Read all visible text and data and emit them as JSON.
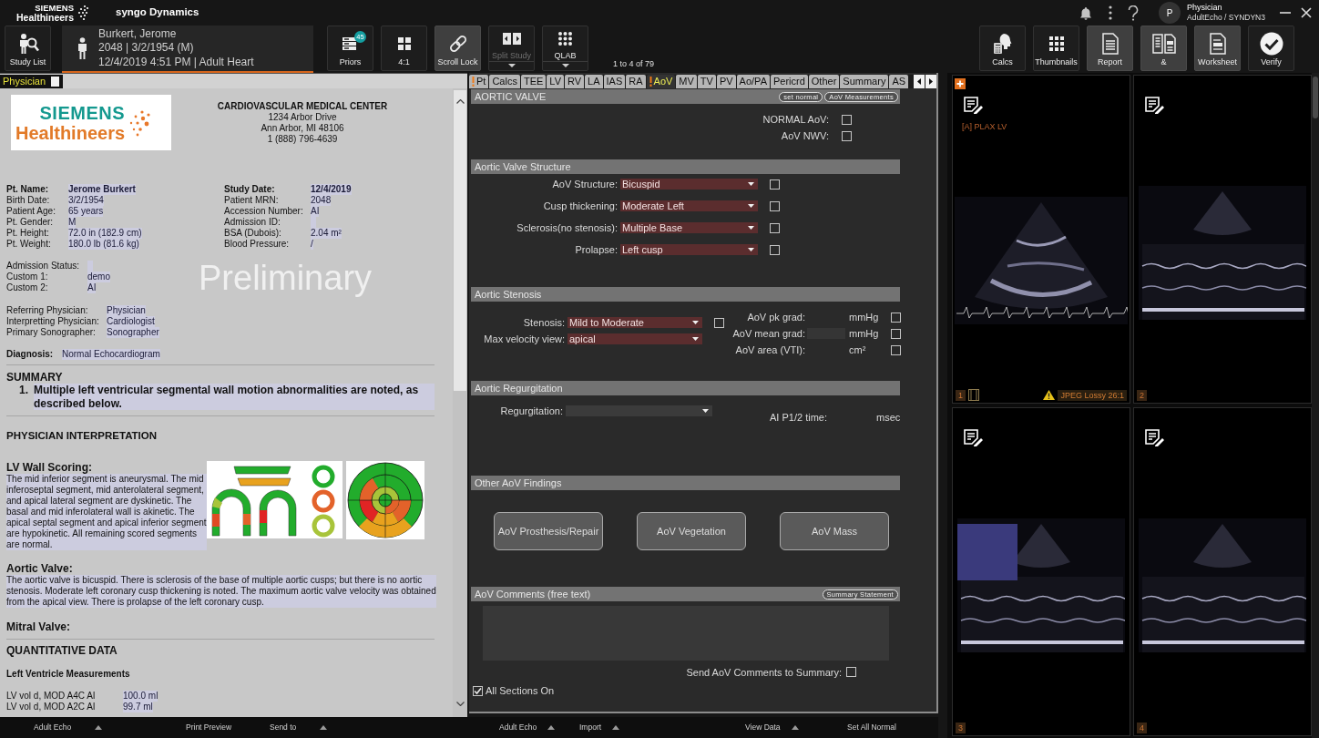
{
  "header": {
    "brand": [
      "SIEMENS",
      "Healthineers"
    ],
    "product": "syngo Dynamics",
    "user": {
      "initial": "P",
      "name": "Physician",
      "context": "AdultEcho / SYNDYN3"
    }
  },
  "toolbar": {
    "left": [
      {
        "kind": "study-list",
        "label": "Study List",
        "selected": false,
        "disabled": false,
        "menu": false
      }
    ],
    "patient": [
      "Burkert, Jerome",
      "2048 | 3/2/1954 (M)",
      "12/4/2019 4:51 PM | Adult Heart"
    ],
    "middle": [
      {
        "kind": "priors",
        "label": "Priors",
        "badge": "45",
        "selected": false,
        "disabled": false,
        "menu": false
      },
      {
        "kind": "layout",
        "label": "4:1",
        "selected": false,
        "disabled": false,
        "menu": false
      },
      {
        "kind": "scroll-lock",
        "label": "Scroll Lock",
        "selected": true,
        "disabled": false,
        "menu": false
      },
      {
        "kind": "split-study",
        "label": "Split Study",
        "selected": false,
        "disabled": true,
        "menu": true
      },
      {
        "kind": "qlab",
        "label": "QLAB",
        "selected": false,
        "disabled": false,
        "menu": true
      }
    ],
    "pager": "1 to 4 of 79",
    "right": [
      {
        "kind": "calcs",
        "label": "Calcs",
        "selected": false,
        "disabled": false,
        "menu": false
      },
      {
        "kind": "thumbnails",
        "label": "Thumbnails",
        "selected": false,
        "disabled": false,
        "menu": false
      },
      {
        "kind": "report",
        "label": "Report",
        "selected": true,
        "disabled": false,
        "menu": false
      },
      {
        "kind": "compare",
        "label": "&",
        "selected": true,
        "disabled": false,
        "menu": false
      },
      {
        "kind": "worksheet",
        "label": "Worksheet",
        "selected": true,
        "disabled": false,
        "menu": false
      },
      {
        "kind": "verify",
        "label": "Verify",
        "selected": false,
        "disabled": false,
        "menu": false
      }
    ]
  },
  "report": {
    "tab": {
      "label": "Physician"
    },
    "logo": [
      "SIEMENS",
      "Healthineers"
    ],
    "facility": [
      "CARDIOVASCULAR MEDICAL CENTER",
      "1234 Arbor Drive",
      "Ann Arbor, MI 48106",
      "1 (888) 796-4639"
    ],
    "watermark": "Preliminary",
    "patient_left": [
      {
        "label": "Pt. Name:",
        "value": "Jerome Burkert",
        "bold": true
      },
      {
        "label": "Birth Date:",
        "value": "3/2/1954",
        "bold": false
      },
      {
        "label": "Patient Age:",
        "value": "65 years",
        "bold": false
      },
      {
        "label": "Pt. Gender:",
        "value": "M",
        "bold": false
      },
      {
        "label": "Pt. Height:",
        "value": "72.0 in (182.9 cm)",
        "bold": false
      },
      {
        "label": "Pt. Weight:",
        "value": "180.0 lb (81.6 kg)",
        "bold": false
      }
    ],
    "patient_right": [
      {
        "label": "Study Date:",
        "value": "12/4/2019",
        "bold": true
      },
      {
        "label": "Patient MRN:",
        "value": "2048",
        "bold": false
      },
      {
        "label": "Accession Number:",
        "value": "AI",
        "bold": false
      },
      {
        "label": "Admission ID:",
        "bold": false
      },
      {
        "label": "BSA (Dubois):",
        "value": "2.04 m²",
        "bold": false
      },
      {
        "label": "Blood Pressure:",
        "value": "/",
        "bold": false
      }
    ],
    "admission": [
      {
        "label": "Admission Status:"
      },
      {
        "label": "Custom 1:",
        "value": "demo"
      },
      {
        "label": "Custom 2:",
        "value": "AI"
      }
    ],
    "staff": [
      {
        "label": "Referring Physician:",
        "value": "Physician"
      },
      {
        "label": "Interpretting Physician:",
        "value": "Cardiologist"
      },
      {
        "label": "Primary Sonographer:",
        "value": "Sonographer"
      }
    ],
    "diagnosis": {
      "label": "Diagnosis:",
      "value": "Normal Echocardiogram"
    },
    "summary": {
      "heading": "SUMMARY",
      "items": [
        {
          "number": "1.",
          "text": "Multiple left ventricular segmental wall motion abnormalities are noted, as described below."
        }
      ]
    },
    "interpretation": {
      "heading": "PHYSICIAN INTERPRETATION",
      "sections": [
        {
          "kind": "figures",
          "heading": "LV Wall Scoring:",
          "text": "The mid inferior segment is aneurysmal. The mid inferoseptal segment, mid anterolateral segment, and apical lateral segment are dyskinetic. The basal and mid inferolateral wall is akinetic. The apical septal segment and apical inferior segment are hypokinetic. All remaining scored segments are normal."
        },
        {
          "kind": "text",
          "heading": "Aortic Valve:",
          "text": "The aortic valve is bicuspid. There is sclerosis of the base of multiple aortic cusps; but there is no aortic stenosis. Moderate left coronary cusp thickening is noted. The maximum aortic valve velocity was obtained from the apical view. There is prolapse of the left coronary cusp."
        },
        {
          "kind": "text",
          "heading": "Mitral Valve:"
        }
      ]
    },
    "quantitative": {
      "heading": "QUANTITATIVE DATA",
      "subheading": "Left Ventricle Measurements",
      "rows": [
        {
          "label": "LV vol d, MOD A4C AI",
          "value": "100.0 ml"
        },
        {
          "label": "LV vol d, MOD A2C AI",
          "value": "99.7 ml"
        }
      ]
    }
  },
  "form": {
    "tabs": [
      {
        "label": "Pt",
        "flagged": true,
        "selected": false
      },
      {
        "label": "Calcs",
        "flagged": false,
        "selected": false
      },
      {
        "label": "TEE",
        "flagged": false,
        "selected": false
      },
      {
        "label": "LV",
        "flagged": false,
        "selected": false
      },
      {
        "label": "RV",
        "flagged": false,
        "selected": false
      },
      {
        "label": "LA",
        "flagged": false,
        "selected": false
      },
      {
        "label": "IAS",
        "flagged": false,
        "selected": false
      },
      {
        "label": "RA",
        "flagged": false,
        "selected": false
      },
      {
        "label": "AoV",
        "flagged": true,
        "selected": true
      },
      {
        "label": "MV",
        "flagged": false,
        "selected": false
      },
      {
        "label": "TV",
        "flagged": false,
        "selected": false
      },
      {
        "label": "PV",
        "flagged": false,
        "selected": false
      },
      {
        "label": "Ao/PA",
        "flagged": false,
        "selected": false
      },
      {
        "label": "Pericrd",
        "flagged": false,
        "selected": false
      },
      {
        "label": "Other",
        "flagged": false,
        "selected": false
      },
      {
        "label": "Summary",
        "flagged": false,
        "selected": false
      },
      {
        "label": "AS",
        "flagged": false,
        "selected": false
      }
    ],
    "sections": [
      {
        "kind": "checks",
        "title": "AORTIC VALVE",
        "header_buttons": [
          "set normal",
          "AoV Measurements"
        ],
        "rows": [
          {
            "label": "NORMAL AoV:",
            "checked": false
          },
          {
            "label": "AoV NWV:",
            "checked": false
          }
        ]
      },
      {
        "kind": "selects",
        "title": "Aortic Valve Structure",
        "rows": [
          {
            "label": "AoV Structure:",
            "value": "Bicuspid",
            "checked": false
          },
          {
            "label": "Cusp thickening:",
            "value": "Moderate Left",
            "checked": false
          },
          {
            "label": "Sclerosis(no stenosis):",
            "value": "Multiple Base",
            "checked": false
          },
          {
            "label": "Prolapse:",
            "value": "Left cusp",
            "checked": false
          }
        ]
      },
      {
        "kind": "stenosis",
        "title": "Aortic Stenosis",
        "rows": [
          {
            "label": "Stenosis:",
            "value": "Mild to Moderate",
            "checked": false
          },
          {
            "label": "Max velocity view:",
            "value": "apical"
          }
        ],
        "measures": [
          {
            "label": "AoV pk grad:",
            "unit": "mmHg",
            "checked": false
          },
          {
            "label": "AoV mean grad:",
            "unit": "mmHg",
            "field": true,
            "checked": false
          },
          {
            "label": "AoV area (VTI):",
            "unit": "cm²",
            "checked": false
          }
        ]
      },
      {
        "kind": "regurgitation",
        "title": "Aortic Regurgitation",
        "rows": [
          {
            "label": "Regurgitation:"
          }
        ],
        "measures": [
          {
            "label": "AI P1/2 time:",
            "unit": "msec"
          }
        ]
      },
      {
        "kind": "buttons",
        "title": "Other AoV Findings",
        "buttons": [
          "AoV Prosthesis/Repair",
          "AoV Vegetation",
          "AoV Mass"
        ]
      },
      {
        "kind": "comments",
        "title": "AoV Comments (free text)",
        "header_buttons": [
          "Summary Statement"
        ],
        "send": {
          "label": "Send AoV Comments to Summary:",
          "checked": false
        }
      }
    ],
    "all_sections": {
      "label": "All Sections On",
      "checked": true
    }
  },
  "viewer": {
    "cells": [
      {
        "number": "1",
        "kind": "sector",
        "label": "[A] PLAX LV",
        "overlay": false,
        "cine": true,
        "notice": "JPEG Lossy 26:1"
      },
      {
        "number": "2",
        "kind": "strip",
        "overlay": false,
        "cine": false
      },
      {
        "number": "3",
        "kind": "strip",
        "overlay": true,
        "cine": false
      },
      {
        "number": "4",
        "kind": "strip",
        "overlay": false,
        "cine": false
      }
    ]
  },
  "footer": {
    "report": [
      {
        "label": "Adult Echo",
        "menu": true
      },
      {
        "label": "Print Preview",
        "menu": false
      },
      {
        "label": "Send to",
        "menu": true
      }
    ],
    "form": [
      {
        "label": "Adult Echo",
        "menu": true
      },
      {
        "label": "Import",
        "menu": true
      },
      {
        "label": "View Data",
        "menu": true
      },
      {
        "label": "Set All Normal",
        "menu": false
      }
    ]
  }
}
